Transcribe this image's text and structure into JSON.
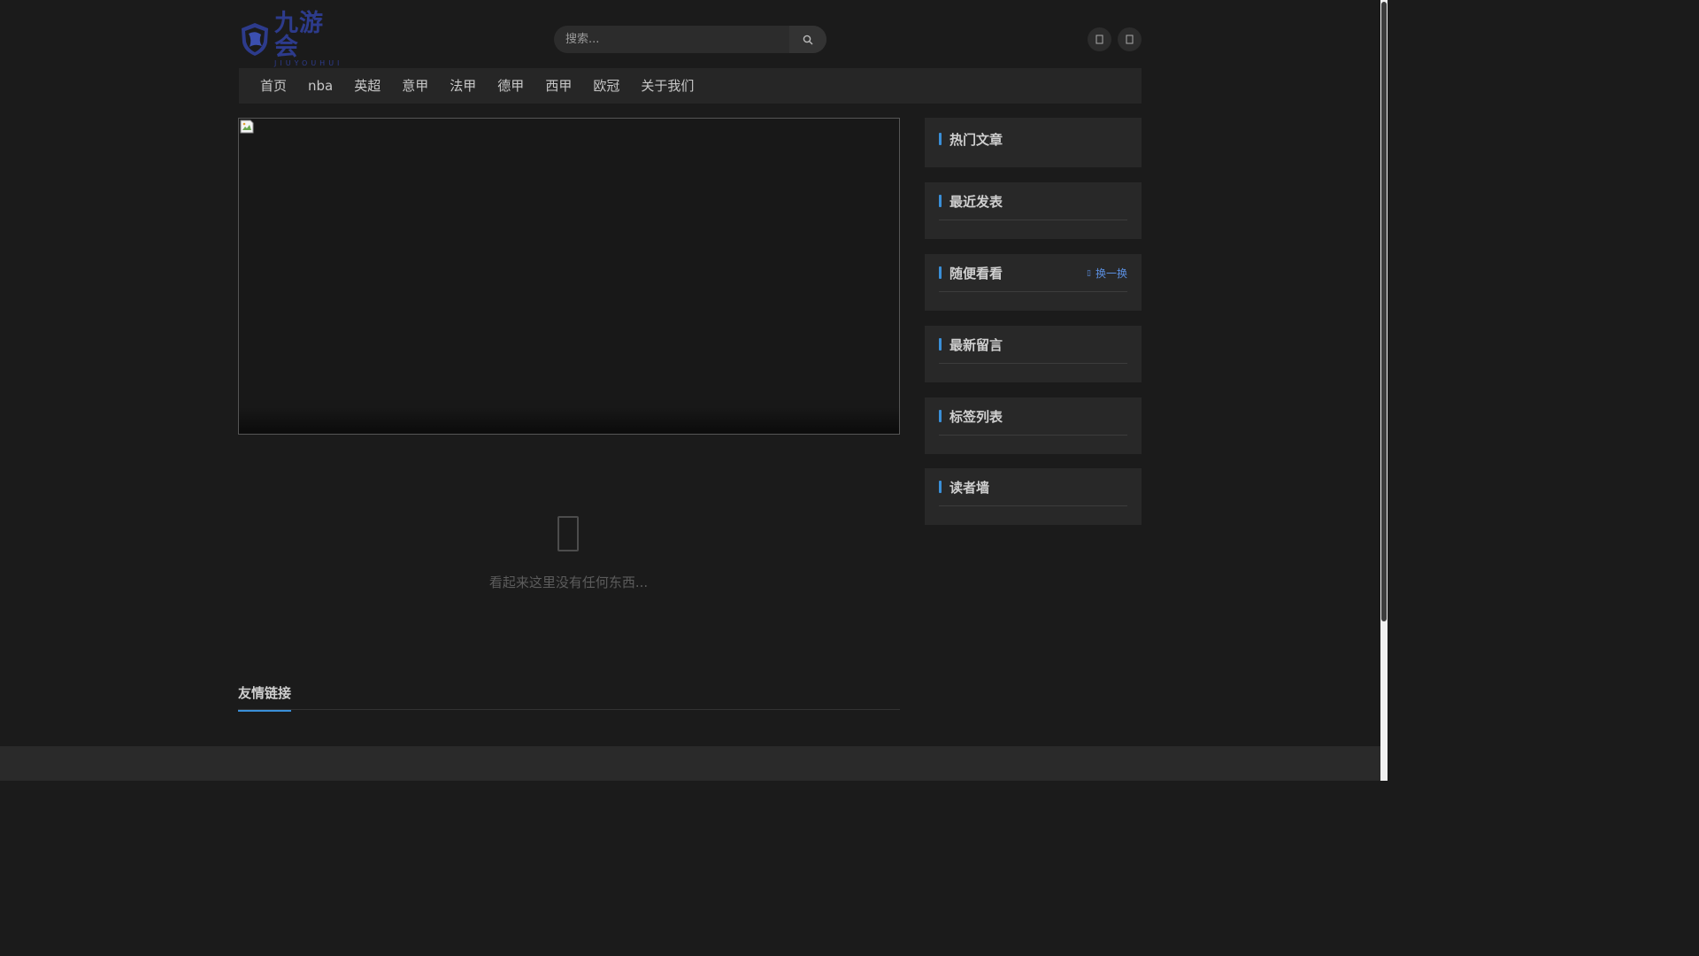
{
  "brand": {
    "name_cn": "九游会",
    "name_en": "JIUYOUHUI"
  },
  "search": {
    "placeholder": "搜索..."
  },
  "nav": {
    "items": [
      "首页",
      "nba",
      "英超",
      "意甲",
      "法甲",
      "德甲",
      "西甲",
      "欧冠",
      "关于我们"
    ]
  },
  "main": {
    "empty_text": "看起来这里没有任何东西..."
  },
  "friend_links": {
    "title": "友情链接"
  },
  "sidebar": {
    "hot_articles": "热门文章",
    "recent_posts": "最近发表",
    "random_look": "随便看看",
    "refresh_label": "换一换",
    "latest_comments": "最新留言",
    "tag_list": "标签列表",
    "reader_wall": "读者墙"
  },
  "colors": {
    "accent": "#3a8fd8",
    "link": "#5b8fe0",
    "background": "#1b1b1b",
    "panel": "#282828"
  }
}
